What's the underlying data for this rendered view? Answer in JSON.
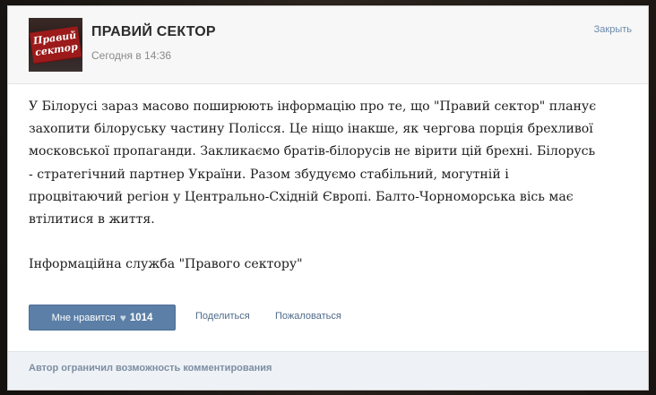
{
  "header": {
    "avatar_logo_text": "Правий сектор",
    "title": "ПРАВИЙ СЕКТОР",
    "time": "Сегодня в 14:36",
    "close_label": "Закрыть"
  },
  "post": {
    "paragraphs": [
      "У Білорусі зараз масово поширюють інформацію про те, що \"Правий сектор\" планує захопити білоруську частину Полісся. Це ніщо інакше, як чергова порція брехливої московської пропаганди. Закликаємо братів-білорусів не вірити цій брехні. Білорусь - стратегічний партнер України. Разом збудуємо стабільний, могутній і процвітаючий регіон у Центрально-Східній Європі. Балто-Чорноморська вісь має втілитися в життя.",
      "Інформаційна служба \"Правого сектору\""
    ]
  },
  "actions": {
    "like_label": "Мне нравится",
    "like_icon": "heart-icon",
    "like_count": "1014",
    "share_label": "Поделиться",
    "report_label": "Пожаловаться"
  },
  "footer": {
    "notice": "Автор ограничил возможность комментирования"
  },
  "colors": {
    "like_button": "#5b7fa6",
    "link": "#4f6b8a",
    "footer_bg": "#eef1f5"
  }
}
